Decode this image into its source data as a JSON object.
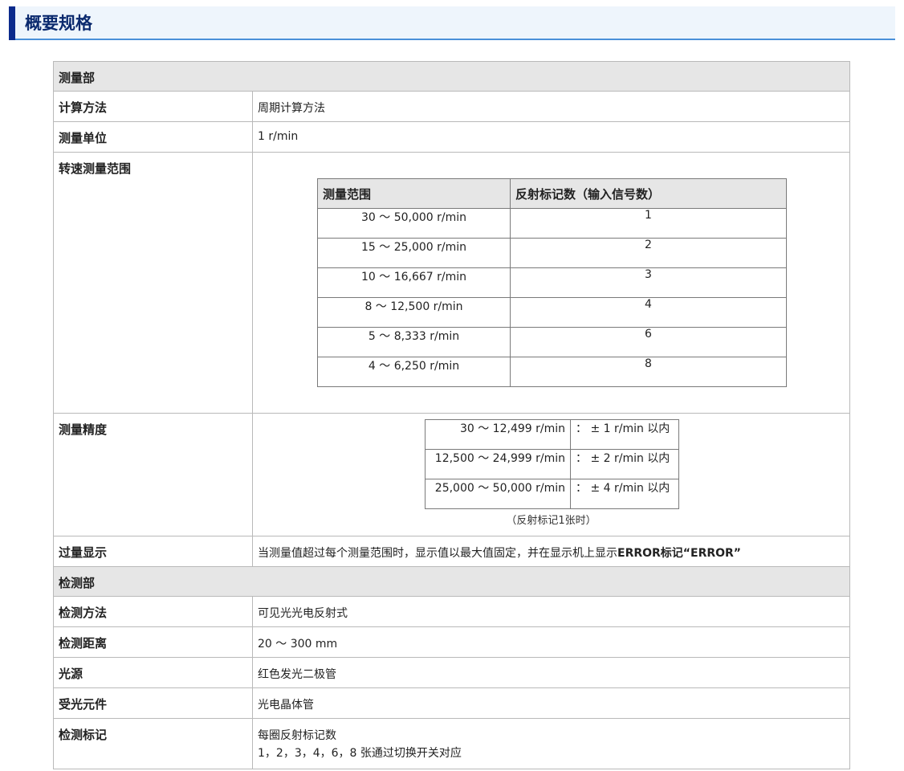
{
  "header": {
    "title": "概要规格"
  },
  "spec": {
    "measure_group": "测量部",
    "calc_label": "计算方法",
    "calc_value": "周期计算方法",
    "unit_label": "测量单位",
    "unit_value": "1 r/min",
    "range_label": "转速测量范围",
    "range_table": {
      "col1": "测量范围",
      "col2": "反射标记数（输入信号数）",
      "rows": [
        [
          "30 ～ 50,000 r/min",
          "1"
        ],
        [
          "15 ～ 25,000 r/min",
          "2"
        ],
        [
          "10 ～ 16,667 r/min",
          "3"
        ],
        [
          "8 ～ 12,500 r/min",
          "4"
        ],
        [
          "5 ～ 8,333 r/min",
          "6"
        ],
        [
          "4 ～ 6,250 r/min",
          "8"
        ]
      ]
    },
    "accuracy_label": "测量精度",
    "accuracy_table": {
      "rows": [
        [
          "30 ～ 12,499 r/min",
          "： ± 1 r/min 以内"
        ],
        [
          "12,500 ～ 24,999 r/min",
          "： ± 2 r/min 以内"
        ],
        [
          "25,000 ～ 50,000 r/min",
          "： ± 4 r/min 以内"
        ]
      ],
      "note": "（反射标记1张时）"
    },
    "over_label": "过量显示",
    "over_value_prefix": "当测量值超过每个测量范围时，显示值以最大值固定，并在显示机上显示",
    "over_value_bold": "ERROR标记“ERROR”",
    "detect_group": "检测部",
    "method_label": "检测方法",
    "method_value": "可见光光电反射式",
    "distance_label": "检测距离",
    "distance_value": "20 ～ 300 mm",
    "light_label": "光源",
    "light_value": "红色发光二极管",
    "receiver_label": "受光元件",
    "receiver_value": "光电晶体管",
    "mark_label": "检测标记",
    "mark_value_1": "每圈反射标记数",
    "mark_value_2": "1，2，3，4，6，8 张通过切换开关对应"
  }
}
